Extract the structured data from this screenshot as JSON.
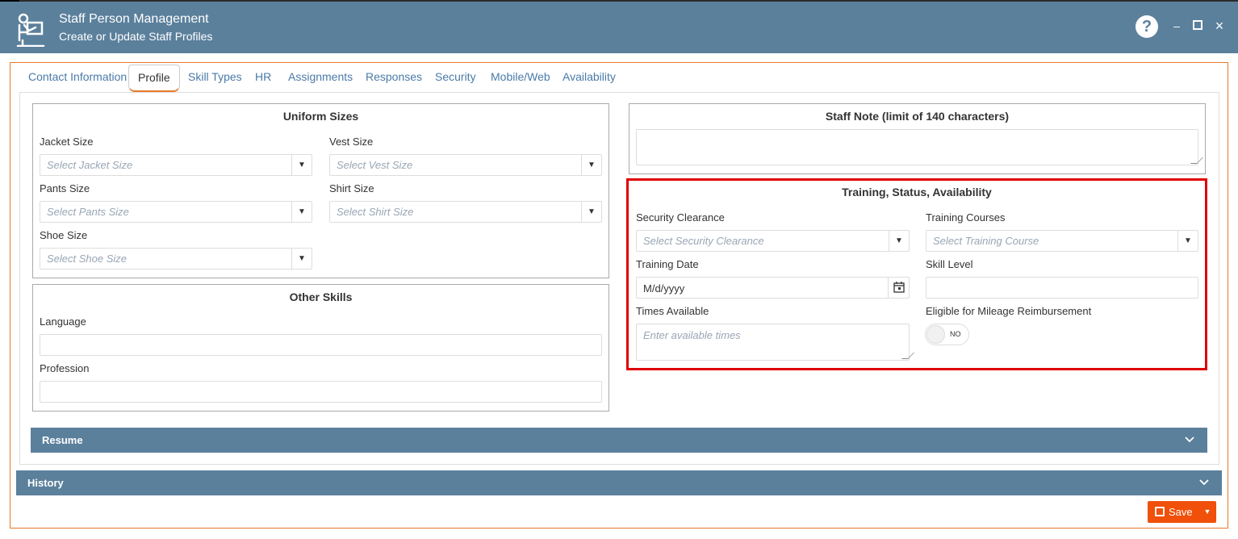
{
  "header": {
    "title": "Staff Person Management",
    "subtitle": "Create or Update Staff Profiles",
    "help_glyph": "?",
    "minimize_glyph": "–",
    "maximize_glyph": "□",
    "close_glyph": "×"
  },
  "tabs": [
    {
      "label": "Contact Information"
    },
    {
      "label": "Profile"
    },
    {
      "label": "Skill Types"
    },
    {
      "label": "HR"
    },
    {
      "label": "Assignments"
    },
    {
      "label": "Responses"
    },
    {
      "label": "Security"
    },
    {
      "label": "Mobile/Web"
    },
    {
      "label": "Availability"
    }
  ],
  "active_tab": "Profile",
  "uniform": {
    "title": "Uniform Sizes",
    "jacket_label": "Jacket Size",
    "jacket_placeholder": "Select Jacket Size",
    "vest_label": "Vest Size",
    "vest_placeholder": "Select Vest Size",
    "pants_label": "Pants Size",
    "pants_placeholder": "Select Pants Size",
    "shirt_label": "Shirt Size",
    "shirt_placeholder": "Select Shirt Size",
    "shoe_label": "Shoe Size",
    "shoe_placeholder": "Select Shoe Size"
  },
  "other_skills": {
    "title": "Other Skills",
    "language_label": "Language",
    "profession_label": "Profession"
  },
  "staff_note": {
    "title": "Staff Note (limit of 140 characters)"
  },
  "training": {
    "title": "Training, Status, Availability",
    "security_label": "Security Clearance",
    "security_placeholder": "Select Security Clearance",
    "courses_label": "Training Courses",
    "courses_placeholder": "Select Training Course",
    "date_label": "Training Date",
    "date_value": "M/d/yyyy",
    "skill_label": "Skill Level",
    "times_label": "Times Available",
    "times_placeholder": "Enter available times",
    "mileage_label": "Eligible for Mileage Reimbursement",
    "mileage_toggle": "NO"
  },
  "sections": {
    "resume": "Resume",
    "history": "History"
  },
  "footer": {
    "save_label": "Save"
  },
  "colors": {
    "header_bg": "#5b809c",
    "accent": "#e8792a",
    "save_bg": "#f0500a",
    "highlight": "#e00000"
  }
}
